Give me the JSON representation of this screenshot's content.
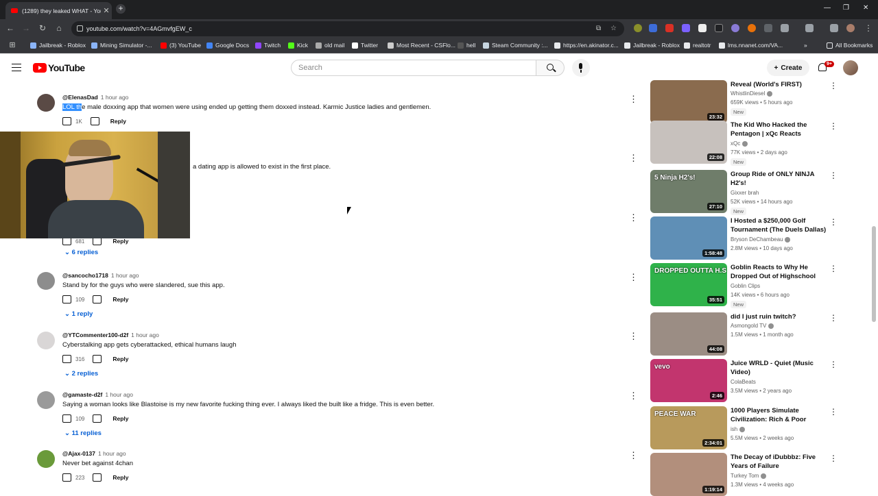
{
  "browser": {
    "tab_title": "(1289) they leaked WHAT - You",
    "url": "youtube.com/watch?v=4AGmvfgEW_c",
    "bookmarks": [
      {
        "label": "Jailbreak - Roblox",
        "color": "#8ab4f8"
      },
      {
        "label": "Mining Simulator -...",
        "color": "#8ab4f8"
      },
      {
        "label": "(3) YouTube",
        "color": "#ff0000"
      },
      {
        "label": "Google Docs",
        "color": "#4285f4"
      },
      {
        "label": "Twitch",
        "color": "#9146ff"
      },
      {
        "label": "Kick",
        "color": "#53fc18"
      },
      {
        "label": "old mail",
        "color": "#aaaaaa"
      },
      {
        "label": "Twitter",
        "color": "#ffffff"
      },
      {
        "label": "Most Recent - CSFlo...",
        "color": "#cccccc"
      },
      {
        "label": "hell",
        "color": "#555555"
      },
      {
        "label": "Steam Community :...",
        "color": "#c7d5e0"
      },
      {
        "label": "https://en.akinator.c...",
        "color": "#e8eaed"
      },
      {
        "label": "Jailbreak - Roblox",
        "color": "#e8eaed"
      },
      {
        "label": "realtotr",
        "color": "#e8eaed"
      },
      {
        "label": "lms.nnanet.com/VA...",
        "color": "#e8eaed"
      }
    ],
    "all_bookmarks": "All Bookmarks"
  },
  "youtube": {
    "logo_text": "YouTube",
    "search_placeholder": "Search",
    "create_label": "Create",
    "notification_count": "9+"
  },
  "comments": [
    {
      "author": "@ElenasDad",
      "time": "1 hour ago",
      "text_highlight": "LOL th",
      "text": "e male doxxing app that women were using ended up getting them doxxed instead. Karmic Justice ladies and gentlemen.",
      "likes": "1K",
      "reply_label": "Reply",
      "replies": "",
      "avatar_color": "#5a4a45"
    },
    {
      "author": "",
      "time": "",
      "text_highlight": "",
      "text": "a dating app is allowed to exist in the first place.",
      "likes": "",
      "reply_label": "",
      "replies": "",
      "avatar_color": "#ffffff"
    },
    {
      "author": "",
      "time": "",
      "text_highlight": "",
      "text": "",
      "likes": "681",
      "reply_label": "Reply",
      "replies": "6 replies",
      "avatar_color": "#ffffff"
    },
    {
      "author": "@sancocho1718",
      "time": "1 hour ago",
      "text_highlight": "",
      "text": "Stand by for the guys who were slandered, sue this app.",
      "likes": "109",
      "reply_label": "Reply",
      "replies": "1 reply",
      "avatar_color": "#8d8d8d"
    },
    {
      "author": "@YTCommenter100-d2f",
      "time": "1 hour ago",
      "text_highlight": "",
      "text": "Cyberstalking app gets cyberattacked, ethical humans laugh",
      "likes": "316",
      "reply_label": "Reply",
      "replies": "2 replies",
      "avatar_color": "#d9d6d6"
    },
    {
      "author": "@gamaste-d2f",
      "time": "1 hour ago",
      "text_highlight": "",
      "text": "Saying a woman looks like Blastoise is my new favorite fucking thing ever. I always liked the built like a fridge. This is even better.",
      "likes": "109",
      "reply_label": "Reply",
      "replies": "11 replies",
      "avatar_color": "#9a9a9a"
    },
    {
      "author": "@Ajax-0137",
      "time": "1 hour ago",
      "text_highlight": "",
      "text": "Never bet against 4chan",
      "likes": "223",
      "reply_label": "Reply",
      "replies": "",
      "avatar_color": "#6a9a3a"
    }
  ],
  "sidebar": [
    {
      "title": "Reveal (World's FIRST)",
      "channel": "WhistlinDiesel",
      "verified": true,
      "meta": "659K views • 5 hours ago",
      "new": "New",
      "duration": "23:32",
      "thumb": "#8a6b4e"
    },
    {
      "title": "The Kid Who Hacked the Pentagon | xQc Reacts",
      "channel": "xQc",
      "verified": true,
      "meta": "77K views • 2 days ago",
      "new": "New",
      "duration": "22:08",
      "thumb": "#c7c1bd"
    },
    {
      "title": "Group Ride of ONLY NINJA H2's!",
      "channel": "Gixxer brah",
      "verified": false,
      "meta": "52K views • 14 hours ago",
      "new": "New",
      "duration": "27:10",
      "thumb": "#6f7d6a",
      "thumb_text": "5 Ninja H2's!"
    },
    {
      "title": "I Hosted a $250,000 Golf Tournament (The Duels Dallas)",
      "channel": "Bryson DeChambeau",
      "verified": true,
      "meta": "2.8M views • 10 days ago",
      "new": "",
      "duration": "1:58:48",
      "thumb": "#5f8fb6"
    },
    {
      "title": "Goblin Reacts to Why He Dropped Out of Highschool",
      "channel": "Goblin Clips",
      "verified": false,
      "meta": "14K views • 6 hours ago",
      "new": "New",
      "duration": "35:51",
      "thumb": "#2fb24a",
      "thumb_text": "DROPPED OUTTA H.S"
    },
    {
      "title": "did I just ruin twitch?",
      "channel": "Asmongold TV",
      "verified": true,
      "meta": "1.5M views • 1 month ago",
      "new": "",
      "duration": "44:08",
      "thumb": "#9b8d84"
    },
    {
      "title": "Juice WRLD - Quiet (Music Video)",
      "channel": "ColaBeats",
      "verified": false,
      "meta": "3.5M views • 2 years ago",
      "new": "",
      "duration": "2:46",
      "thumb": "#c2356e",
      "thumb_text": "vevo"
    },
    {
      "title": "1000 Players Simulate Civilization: Rich & Poor",
      "channel": "ish",
      "verified": true,
      "meta": "5.5M views • 2 weeks ago",
      "new": "",
      "duration": "2:34:01",
      "thumb": "#b89a5c",
      "thumb_text": "PEACE WAR"
    },
    {
      "title": "The Decay of iDubbbz: Five Years of Failure",
      "channel": "Turkey Tom",
      "verified": true,
      "meta": "1.3M views • 4 weeks ago",
      "new": "",
      "duration": "1:19:14",
      "thumb": "#b28f7c"
    }
  ]
}
